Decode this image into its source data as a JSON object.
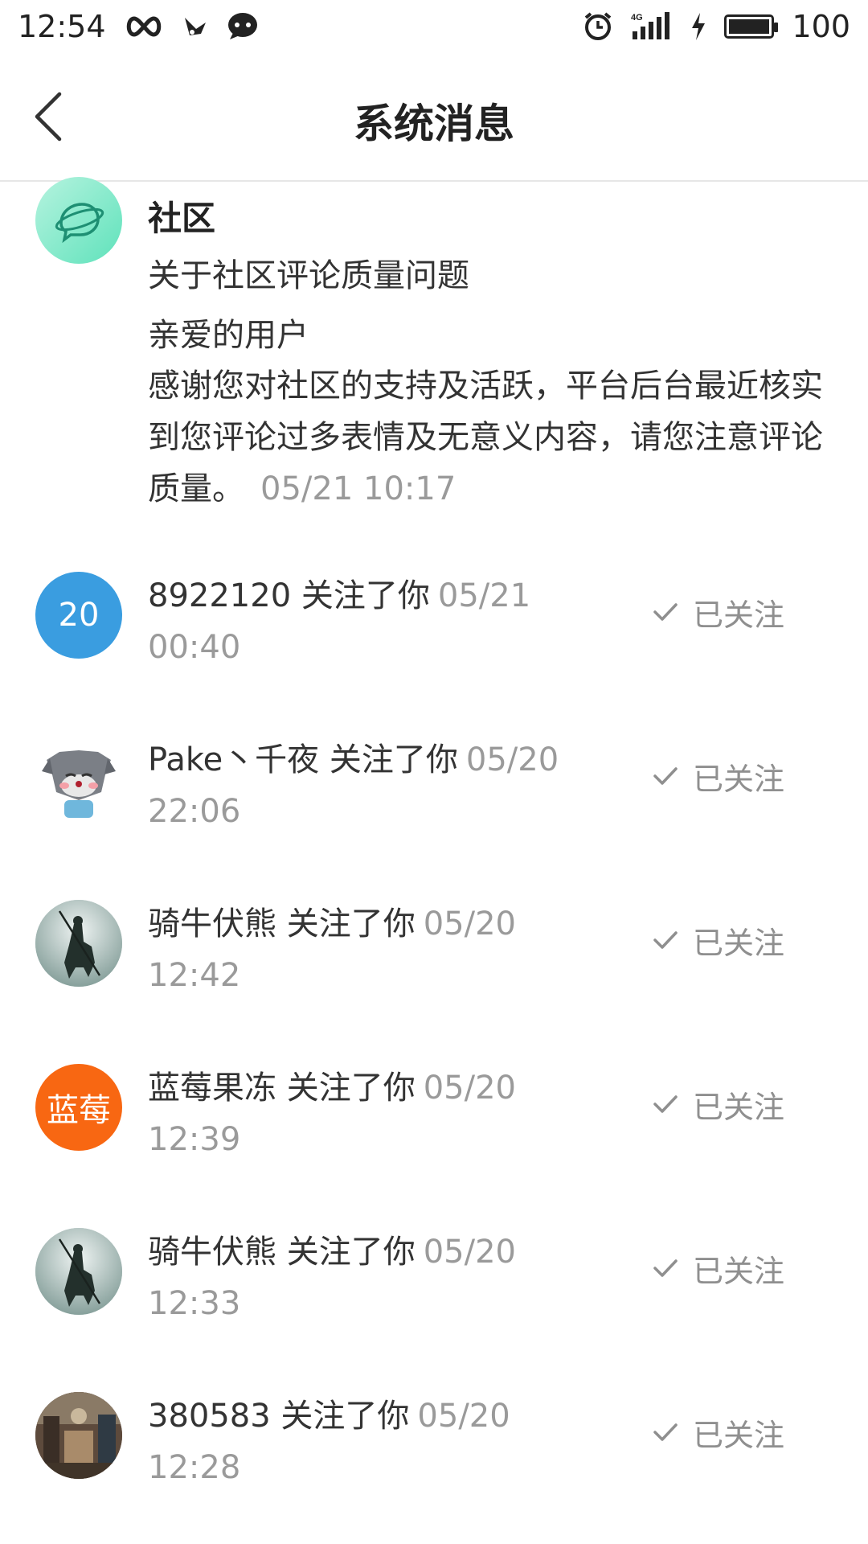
{
  "status_bar": {
    "time": "12:54",
    "battery_level": "100",
    "battery_fraction": 1.0,
    "network": "4G",
    "icons": [
      "infinity-icon",
      "bird-icon",
      "chat-icon",
      "alarm-icon",
      "signal-icon",
      "charging-icon",
      "battery-icon"
    ]
  },
  "header": {
    "title": "系统消息",
    "back_icon": "chevron-left-icon"
  },
  "system_message": {
    "sender": "社区",
    "subject": "关于社区评论质量问题",
    "greeting": "亲爱的用户",
    "body": "感谢您对社区的支持及活跃，平台后台最近核实到您评论过多表情及无意义内容，请您注意评论质量。",
    "time": "05/21 10:17",
    "avatar_icon": "planet-chat-icon"
  },
  "follows": [
    {
      "user": "8922120",
      "action": "关注了你",
      "time": "05/21 00:40",
      "button": "已关注",
      "avatar_text": "20",
      "avatar_color": "#3a9de0"
    },
    {
      "user": "Pake丶千夜",
      "action": "关注了你",
      "time": "05/20 22:06",
      "button": "已关注",
      "avatar_text": "",
      "avatar_color": "#ffffff"
    },
    {
      "user": "骑牛伏熊",
      "action": "关注了你",
      "time": "05/20 12:42",
      "button": "已关注",
      "avatar_text": "",
      "avatar_color": "#b8c9c8"
    },
    {
      "user": "蓝莓果冻",
      "action": "关注了你",
      "time": "05/20 12:39",
      "button": "已关注",
      "avatar_text": "蓝莓",
      "avatar_color": "#f86712"
    },
    {
      "user": "骑牛伏熊",
      "action": "关注了你",
      "time": "05/20 12:33",
      "button": "已关注",
      "avatar_text": "",
      "avatar_color": "#b8c9c8"
    },
    {
      "user": "380583",
      "action": "关注了你",
      "time": "05/20 12:28",
      "button": "已关注",
      "avatar_text": "",
      "avatar_color": "#6d5b4b"
    }
  ]
}
